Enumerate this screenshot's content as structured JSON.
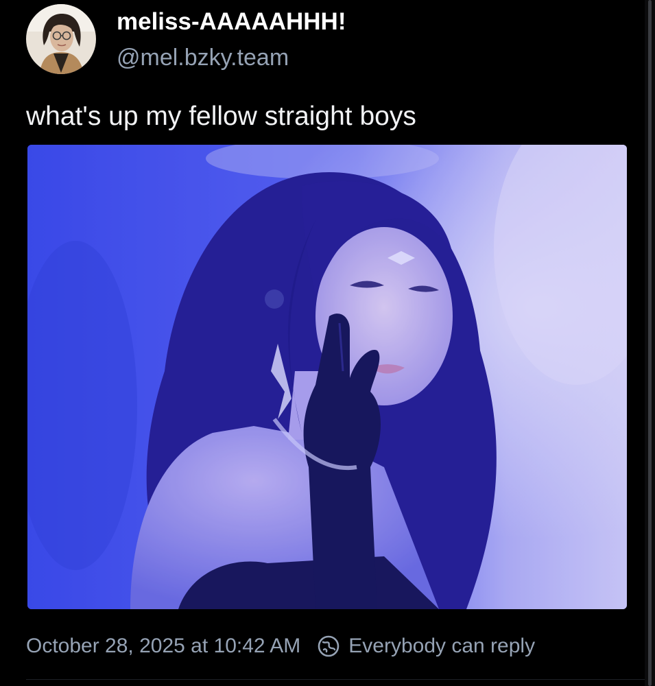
{
  "post": {
    "author": {
      "display_name": "meliss-AAAAAHHH!",
      "handle": "@mel.bzky.team",
      "avatar_icon": "avatar-photo"
    },
    "text": "what's up my fellow straight boys",
    "media": {
      "type": "photo",
      "tint_color": "#3f4fe6"
    },
    "timestamp": "October 28, 2025 at 10:42 AM",
    "reply_setting": {
      "label": "Everybody can reply",
      "icon": "globe-icon"
    }
  },
  "colors": {
    "background": "#000000",
    "secondary_text": "#96a3b5",
    "primary_text": "#ffffff"
  }
}
